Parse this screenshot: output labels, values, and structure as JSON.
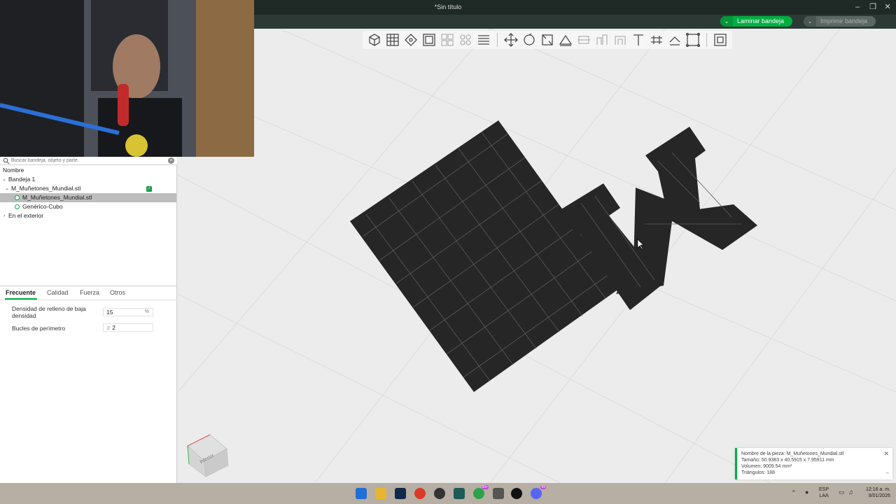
{
  "window": {
    "title": "*Sin título",
    "minimize_icon": "minimize-icon",
    "maximize_icon": "restore-icon",
    "close_icon": "close-icon"
  },
  "top_actions": {
    "slice_label": "Laminar bandeja",
    "print_label": "Imprimir bandeja"
  },
  "toolbar": {
    "tools": [
      "add-object-icon",
      "add-plate-icon",
      "auto-orient-icon",
      "arrange-icon",
      "split-objects-icon",
      "split-parts-icon",
      "layers-icon",
      "move-icon",
      "rotate-icon",
      "scale-icon",
      "lay-on-face-icon",
      "cut-icon",
      "support-paint-icon",
      "seam-paint-icon",
      "text-icon",
      "measure-icon",
      "assembly-icon",
      "mesh-boolean-icon",
      "variable-layer-icon"
    ]
  },
  "search": {
    "placeholder": "Buscar bandeja, objeto y parte."
  },
  "tree": {
    "header": "Nombre",
    "plate": "Bandeja 1",
    "object": "M_Muñetones_Mundial.stl",
    "part": "M_Muñetones_Mundial.stl",
    "modifier": "Genérico-Cubo",
    "outside": "En el exterior"
  },
  "settings": {
    "tabs": [
      "Frecuente",
      "Calidad",
      "Fuerza",
      "Otros"
    ],
    "active_tab": "Frecuente",
    "infill_label": "Densidad de relleno de baja densidad",
    "infill_value": "15",
    "infill_unit": "%",
    "walls_label": "Bucles de perímetro",
    "walls_value": "2"
  },
  "view_cube": {
    "label": "Inferior"
  },
  "info": {
    "name_line": "Nombre de la pieza: M_Muñetones_Mundial.stl",
    "size_line": "Tamaño: 50.9383 x 40.5915 x 7.95911 mm",
    "volume_line": "Volumen: 9009.54 mm³",
    "triangles_line": "Triángulos: 188"
  },
  "taskbar": {
    "whatsapp_badge": "99+",
    "discord_badge": "99",
    "lang_line1": "ESP",
    "lang_line2": "LAA",
    "time": "12:16 a. m.",
    "date": "8/01/2026"
  },
  "colors": {
    "accent": "#00ae42",
    "model": "#262626",
    "titlebar": "#1f2a26"
  }
}
